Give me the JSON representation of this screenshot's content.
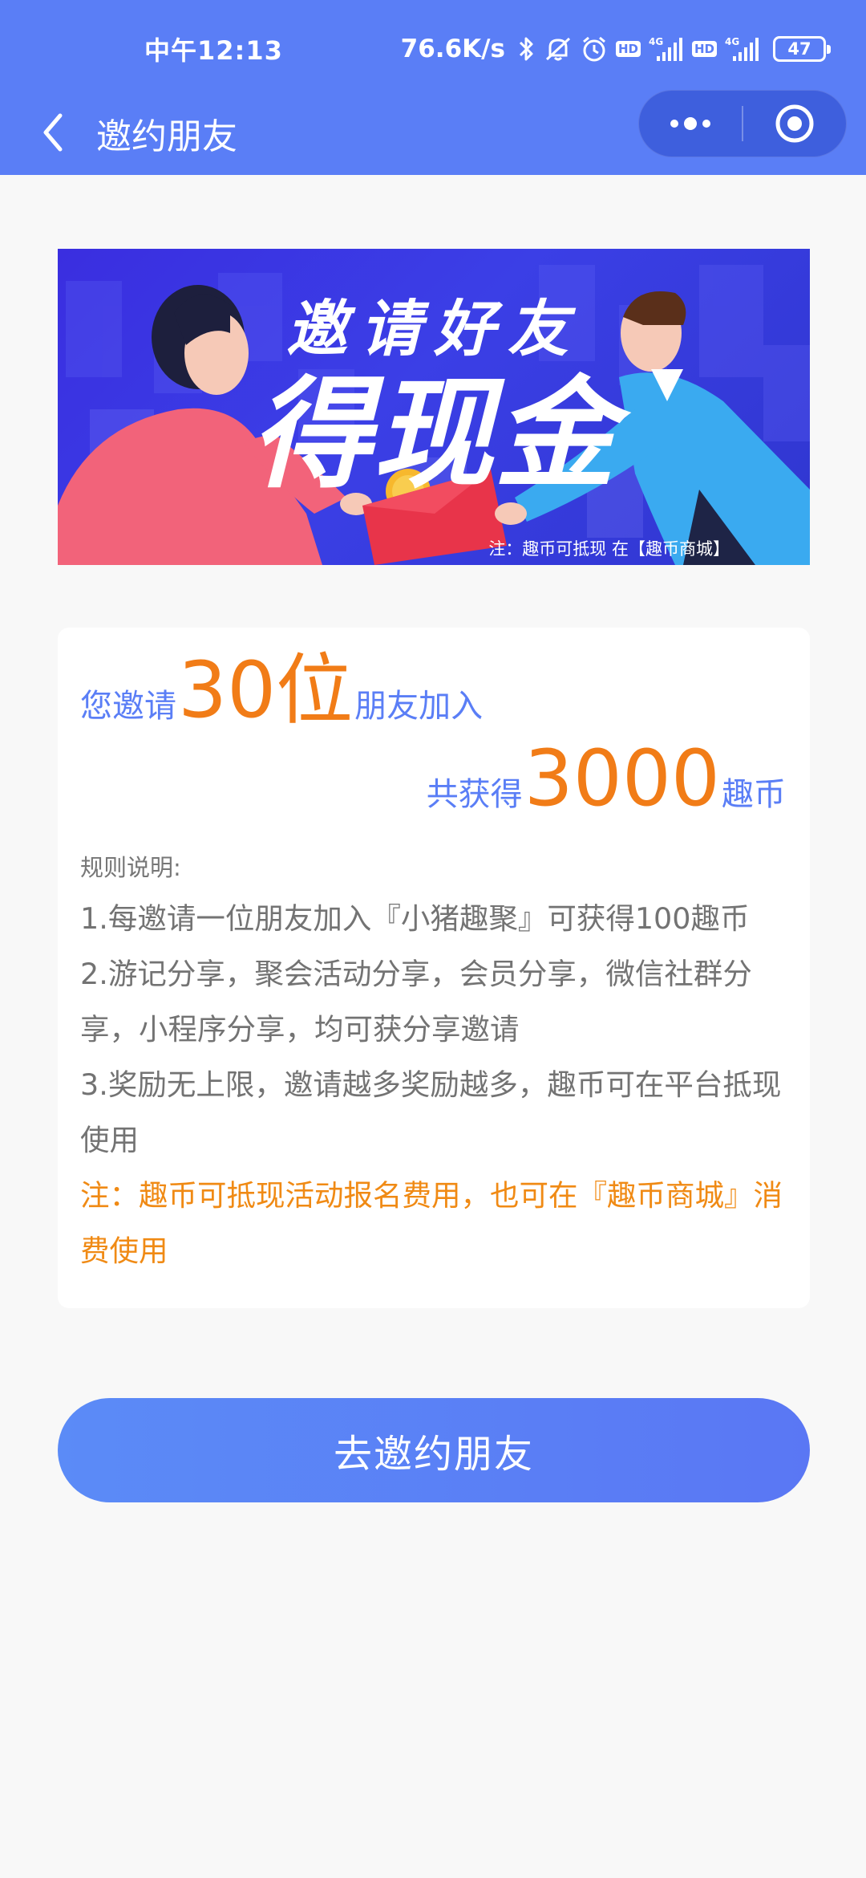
{
  "status_bar": {
    "time": "中午12:13",
    "net_speed": "76.6K/s",
    "hd1": "HD",
    "hd2": "HD",
    "battery": "47"
  },
  "nav": {
    "title": "邀约朋友",
    "theme_color": "#5a7ef6"
  },
  "banner": {
    "line1": "邀请好友",
    "line2": "得现金",
    "note": "注：趣币可抵现 在【趣币商城】"
  },
  "card": {
    "invite_prefix": "您邀请",
    "invite_count": "30位",
    "invite_suffix": "朋友加入",
    "earn_prefix": "共获得",
    "earn_amount": "3000",
    "earn_suffix": "趣币",
    "rules_title": "规则说明:",
    "rules": [
      "1.每邀请一位朋友加入『小猪趣聚』可获得100趣币",
      "2.游记分享，聚会活动分享，会员分享，微信社群分享，小程序分享，均可获分享邀请",
      "3.奖励无上限，邀请越多奖励越多，趣币可在平台抵现使用"
    ],
    "note": "注：趣币可抵现活动报名费用，也可在『趣币商城』消费使用",
    "highlight_color": "#f17c17"
  },
  "action": {
    "button_label": "去邀约朋友"
  }
}
